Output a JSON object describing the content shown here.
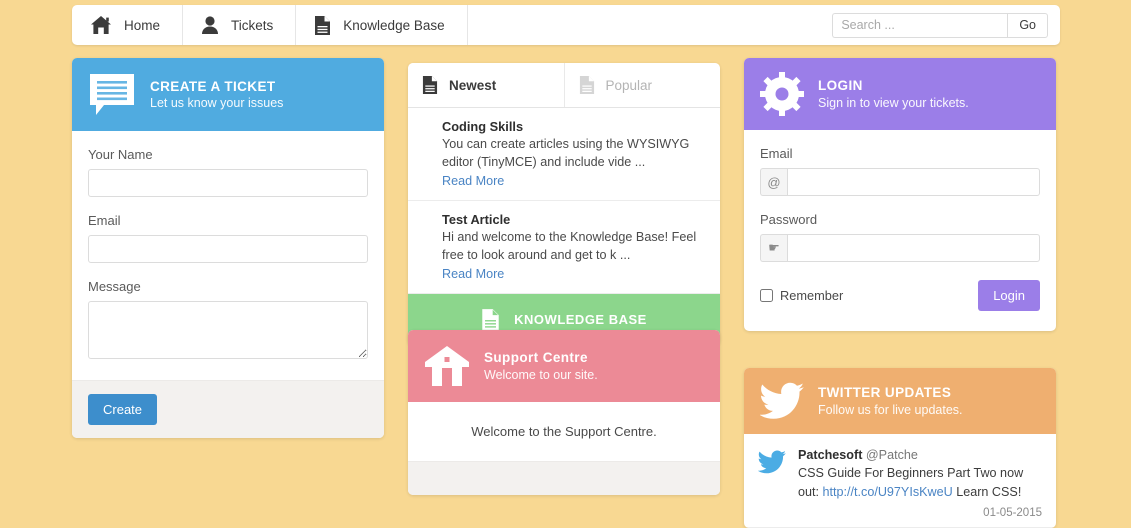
{
  "nav": {
    "items": [
      {
        "label": "Home",
        "icon": "home-icon"
      },
      {
        "label": "Tickets",
        "icon": "user-icon"
      },
      {
        "label": "Knowledge Base",
        "icon": "document-icon"
      }
    ],
    "search": {
      "placeholder": "Search ...",
      "value": "",
      "button_label": "Go"
    }
  },
  "ticket_panel": {
    "title": "CREATE A TICKET",
    "subtitle": "Let us know your issues",
    "icon": "speech-bubble-icon",
    "header_color": "#50ABE0",
    "fields": [
      {
        "label": "Your Name",
        "value": ""
      },
      {
        "label": "Email",
        "value": ""
      },
      {
        "label": "Message",
        "value": ""
      }
    ],
    "submit_label": "Create",
    "submit_color": "#3d8ecc"
  },
  "articles_panel": {
    "tabs": [
      {
        "label": "Newest",
        "icon": "document-icon",
        "active": true
      },
      {
        "label": "Popular",
        "icon": "document-icon",
        "active": false
      }
    ],
    "articles": [
      {
        "title": "Coding Skills",
        "excerpt": "You can create articles using the WYSIWYG editor (TinyMCE) and include vide ...",
        "read_more": "Read More"
      },
      {
        "title": "Test Article",
        "excerpt": "Hi and welcome to the Knowledge Base! Feel free to look around and get to k ...",
        "read_more": "Read More"
      }
    ],
    "kb_button": {
      "label": "KNOWLEDGE BASE",
      "icon": "document-icon",
      "color": "#8CD68C"
    }
  },
  "support_panel": {
    "title": "Support Centre",
    "subtitle": "Welcome to our site.",
    "icon": "house-icon",
    "header_color": "#EC8A96",
    "body_text": "Welcome to the Support Centre."
  },
  "login_panel": {
    "title": "LOGIN",
    "subtitle": "Sign in to view your tickets.",
    "icon": "gear-icon",
    "header_color": "#9B7EE8",
    "email": {
      "label": "Email",
      "addon_icon": "at-sign-icon",
      "addon_glyph": "@",
      "value": ""
    },
    "password": {
      "label": "Password",
      "addon_icon": "key-icon",
      "addon_glyph": "☛",
      "value": ""
    },
    "remember_label": "Remember",
    "remember_checked": false,
    "submit_label": "Login",
    "submit_color": "#9B7EE8"
  },
  "twitter_panel": {
    "title": "TWITTER UPDATES",
    "subtitle": "Follow us for live updates.",
    "icon": "twitter-bird-icon",
    "header_color": "#EFAF70",
    "tweet": {
      "user": "Patchesoft",
      "handle": "@Patche",
      "text_before": "CSS Guide For Beginners Part Two now out: ",
      "link": "http://t.co/U97YIsKweU",
      "text_after": " Learn CSS!",
      "date": "01-05-2015"
    }
  }
}
